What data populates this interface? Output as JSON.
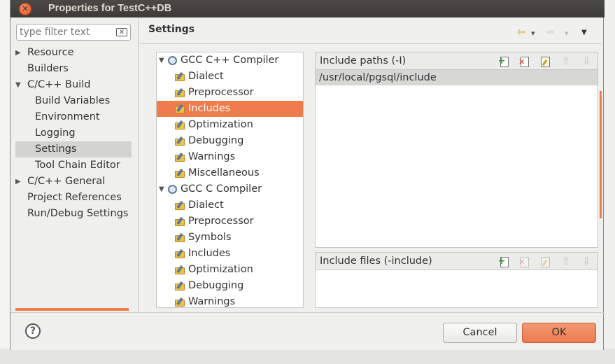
{
  "window": {
    "title": "Properties for TestC++DB"
  },
  "filter": {
    "placeholder": "type filter text"
  },
  "nav": {
    "items": [
      {
        "label": "Resource",
        "level": 0,
        "arrow": "▶"
      },
      {
        "label": "Builders",
        "level": 0,
        "arrow": ""
      },
      {
        "label": "C/C++ Build",
        "level": 0,
        "arrow": "▼"
      },
      {
        "label": "Build Variables",
        "level": 1,
        "arrow": ""
      },
      {
        "label": "Environment",
        "level": 1,
        "arrow": ""
      },
      {
        "label": "Logging",
        "level": 1,
        "arrow": ""
      },
      {
        "label": "Settings",
        "level": 1,
        "arrow": "",
        "selected": true
      },
      {
        "label": "Tool Chain Editor",
        "level": 1,
        "arrow": ""
      },
      {
        "label": "C/C++ General",
        "level": 0,
        "arrow": "▶"
      },
      {
        "label": "Project References",
        "level": 0,
        "arrow": ""
      },
      {
        "label": "Run/Debug Settings",
        "level": 0,
        "arrow": ""
      }
    ]
  },
  "page": {
    "title": "Settings"
  },
  "tool_tree": {
    "items": [
      {
        "label": "GCC C++ Compiler",
        "type": "tool",
        "twisty": "▼"
      },
      {
        "label": "Dialect",
        "type": "opt"
      },
      {
        "label": "Preprocessor",
        "type": "opt"
      },
      {
        "label": "Includes",
        "type": "opt",
        "selected": true
      },
      {
        "label": "Optimization",
        "type": "opt"
      },
      {
        "label": "Debugging",
        "type": "opt"
      },
      {
        "label": "Warnings",
        "type": "opt"
      },
      {
        "label": "Miscellaneous",
        "type": "opt"
      },
      {
        "label": "GCC C Compiler",
        "type": "tool",
        "twisty": "▼"
      },
      {
        "label": "Dialect",
        "type": "opt"
      },
      {
        "label": "Preprocessor",
        "type": "opt"
      },
      {
        "label": "Symbols",
        "type": "opt"
      },
      {
        "label": "Includes",
        "type": "opt"
      },
      {
        "label": "Optimization",
        "type": "opt"
      },
      {
        "label": "Debugging",
        "type": "opt"
      },
      {
        "label": "Warnings",
        "type": "opt"
      }
    ]
  },
  "include_paths": {
    "label": "Include paths (-I)",
    "rows": [
      "/usr/local/pgsql/include"
    ]
  },
  "include_files": {
    "label": "Include files (-include)",
    "rows": []
  },
  "buttons": {
    "cancel": "Cancel",
    "ok": "OK",
    "help": "?"
  },
  "nav_arrows": {
    "back": "⇦",
    "forward": "⇨",
    "dropdown": "▾",
    "menu": "▼"
  },
  "colors": {
    "accent": "#ef7c4d",
    "titlebar": "#3c3b37"
  }
}
